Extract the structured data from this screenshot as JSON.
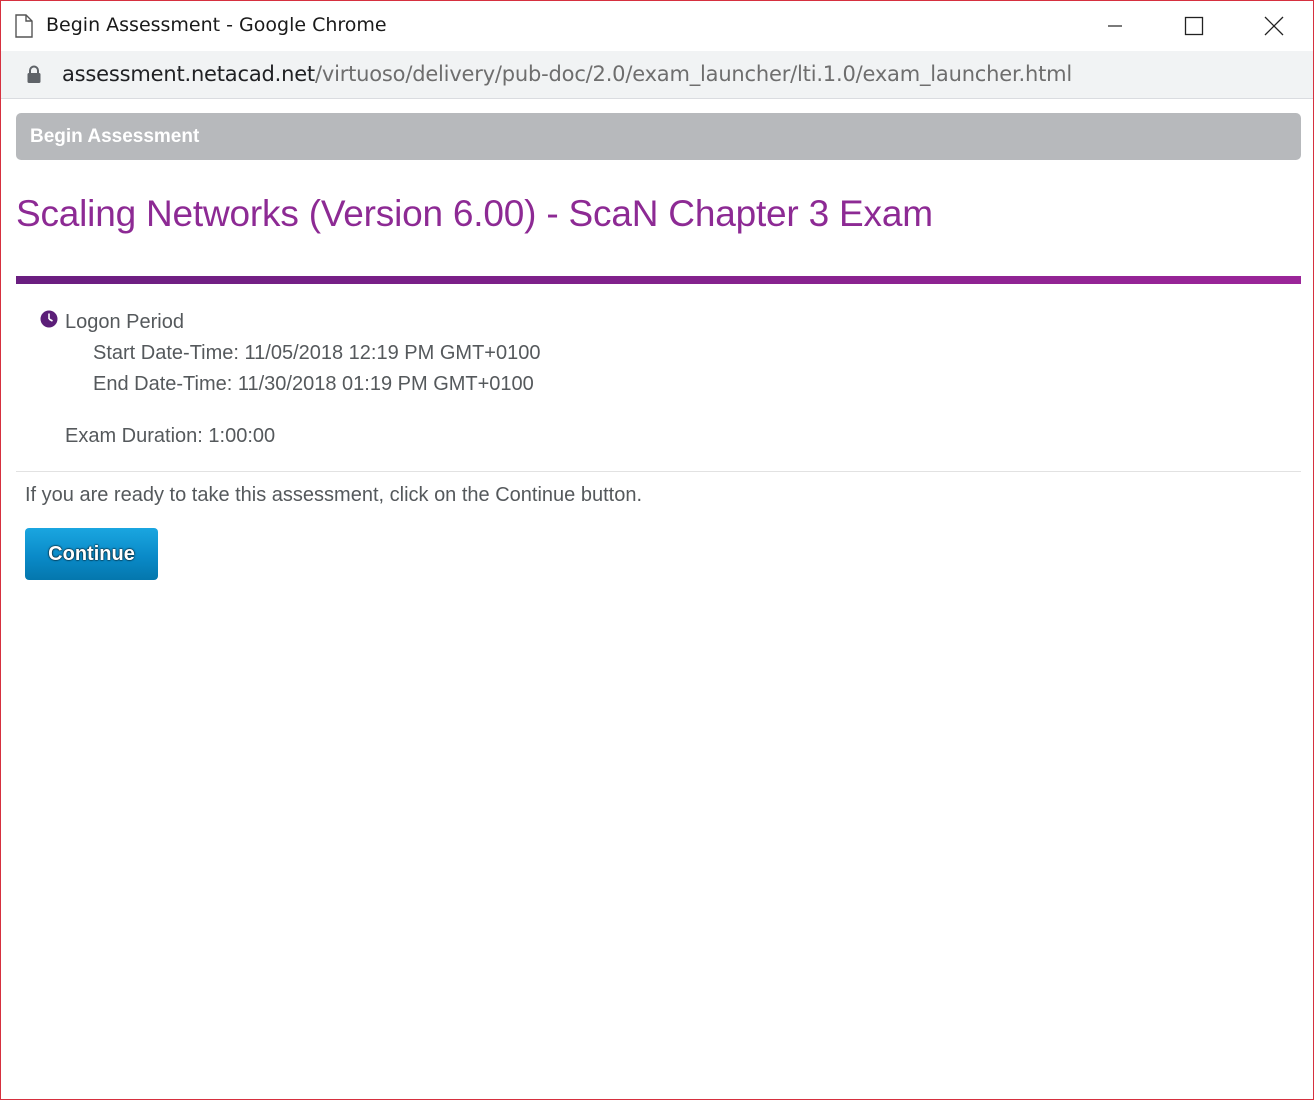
{
  "window": {
    "title": "Begin Assessment - Google Chrome"
  },
  "address_bar": {
    "host": "assessment.netacad.net",
    "path": "/virtuoso/delivery/pub-doc/2.0/exam_launcher/lti.1.0/exam_launcher.html"
  },
  "page": {
    "header": "Begin Assessment",
    "exam_title": "Scaling Networks (Version 6.00) - ScaN Chapter 3 Exam",
    "logon_period_label": "Logon Period",
    "start_datetime": "Start Date-Time: 11/05/2018 12:19 PM GMT+0100",
    "end_datetime": "End Date-Time: 11/30/2018 01:19 PM GMT+0100",
    "exam_duration": "Exam Duration: 1:00:00",
    "instruction": "If you are ready to take this assessment, click on the Continue button.",
    "continue_label": "Continue"
  },
  "colors": {
    "accent_purple": "#8d2a94",
    "header_gray": "#b7b9bc",
    "button_blue": "#0a8ac8",
    "window_border": "#d6303f"
  },
  "icons": [
    "document-icon",
    "minimize-icon",
    "maximize-icon",
    "close-icon",
    "lock-icon",
    "clock-icon"
  ]
}
